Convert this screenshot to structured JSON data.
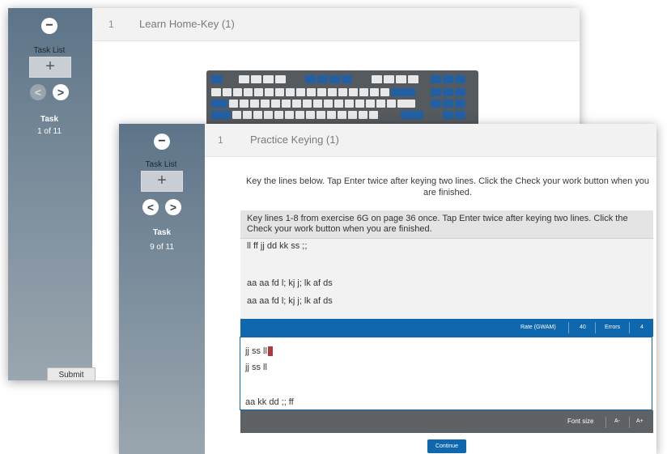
{
  "back_window": {
    "tasklist_label": "Task List",
    "tasklist_plus": "+",
    "collapse_symbol": "−",
    "nav_prev": "<",
    "nav_next": ">",
    "task_title": "Task",
    "task_count": "1 of 11",
    "submit_label": "Submit",
    "task_number": "1",
    "task_name": "Learn Home-Key (1)",
    "keyboard_icon": "keyboard-image"
  },
  "front_window": {
    "tasklist_label": "Task List",
    "tasklist_plus": "+",
    "collapse_symbol": "−",
    "nav_prev": "<",
    "nav_next": ">",
    "task_title": "Task",
    "task_count": "9 of 11",
    "task_number": "1",
    "task_name": "Practice Keying (1)",
    "instruction": "Key the lines below. Tap Enter twice after keying two lines. Click the Check your work button when you are finished.",
    "exercise_header": "Key lines 1-8 from exercise 6G on page 36 once. Tap Enter twice after keying two lines. Click the Check your work button when you are finished.",
    "source_lines": [
      "ll ff jj dd kk ss ;;",
      "aa aa fd l; kj j; lk af ds",
      "aa aa fd l; kj j; lk af ds"
    ],
    "rate_label": "Rate (GWAM)",
    "rate_value": "40",
    "errors_label": "Errors",
    "errors_value": "4",
    "typed_lines": [
      "jj ss ll",
      "jj ss ll",
      "aa kk dd ;; ff"
    ],
    "font_size_label": "Font size",
    "font_smaller": "A-",
    "font_larger": "A+",
    "continue_label": "Continue"
  },
  "colors": {
    "accent_blue": "#0f68ad",
    "sidebar": "#5d7488",
    "cursor": "#b03a3a",
    "bottom_bar": "#5f6264"
  }
}
